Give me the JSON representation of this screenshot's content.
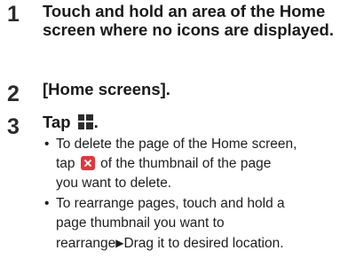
{
  "steps": [
    {
      "number": "1",
      "text": "Touch and hold an area of the Home screen where no icons are displayed."
    },
    {
      "number": "2",
      "text": "[Home screens]."
    },
    {
      "number": "3",
      "text_before_icon": "Tap ",
      "icon": "plus-icon",
      "text_after_icon": "."
    }
  ],
  "bullets": [
    {
      "line1": "To delete the page of the Home screen,",
      "line2_before_icon": "tap ",
      "icon": "delete-x-icon",
      "line2_after_icon": " of the thumbnail of the page",
      "line3": "you want to delete."
    },
    {
      "line1": "To rearrange pages, touch and hold a",
      "line2": "page thumbnail you want to",
      "line3_before_arrow": "rearrange",
      "arrow": "▶",
      "line3_after_arrow": "Drag it to desired location."
    }
  ],
  "bullet_symbol": "•",
  "colors": {
    "delete_icon": "#e5343a",
    "plus_icon_bg": "#2c2c2c"
  }
}
